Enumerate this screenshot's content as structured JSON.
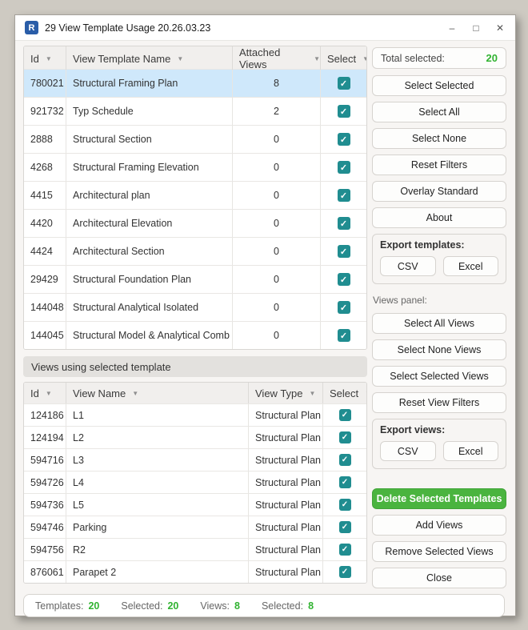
{
  "window": {
    "title": "29 View Template Usage 20.26.03.23",
    "icon_letter": "R",
    "controls": {
      "minimize": "–",
      "maximize": "□",
      "close": "✕"
    }
  },
  "colors": {
    "logo_blue": "#2a5da8",
    "accent_green": "#31b331",
    "checkbox_teal": "#208d90",
    "selected_row_blue": "#cfe8fb",
    "delete_button_green": "#4ab43f"
  },
  "icons": {
    "filter_arrow": "▼",
    "checkmark": "✓"
  },
  "templates_table": {
    "columns": [
      "Id",
      "View Template Name",
      "Attached Views",
      "Select"
    ],
    "rows": [
      {
        "id": "780021",
        "name": "Structural Framing Plan",
        "attached": "8",
        "checked": true,
        "selected": true
      },
      {
        "id": "921732",
        "name": "Typ Schedule",
        "attached": "2",
        "checked": true,
        "selected": false
      },
      {
        "id": "2888",
        "name": "Structural Section",
        "attached": "0",
        "checked": true,
        "selected": false
      },
      {
        "id": "4268",
        "name": "Structural Framing Elevation",
        "attached": "0",
        "checked": true,
        "selected": false
      },
      {
        "id": "4415",
        "name": "Architectural plan",
        "attached": "0",
        "checked": true,
        "selected": false
      },
      {
        "id": "4420",
        "name": "Architectural Elevation",
        "attached": "0",
        "checked": true,
        "selected": false
      },
      {
        "id": "4424",
        "name": "Architectural Section",
        "attached": "0",
        "checked": true,
        "selected": false
      },
      {
        "id": "29429",
        "name": "Structural Foundation Plan",
        "attached": "0",
        "checked": true,
        "selected": false
      },
      {
        "id": "144048",
        "name": "Structural Analytical Isolated",
        "attached": "0",
        "checked": true,
        "selected": false
      },
      {
        "id": "144045",
        "name": "Structural Model & Analytical Comb",
        "attached": "0",
        "checked": true,
        "selected": false
      }
    ]
  },
  "views_section_label": "Views using selected template",
  "views_table": {
    "columns": [
      "Id",
      "View Name",
      "View Type",
      "Select"
    ],
    "rows": [
      {
        "id": "124186",
        "name": "L1",
        "type": "Structural Plan",
        "checked": true
      },
      {
        "id": "124194",
        "name": "L2",
        "type": "Structural Plan",
        "checked": true
      },
      {
        "id": "594716",
        "name": "L3",
        "type": "Structural Plan",
        "checked": true
      },
      {
        "id": "594726",
        "name": "L4",
        "type": "Structural Plan",
        "checked": true
      },
      {
        "id": "594736",
        "name": "L5",
        "type": "Structural Plan",
        "checked": true
      },
      {
        "id": "594746",
        "name": "Parking",
        "type": "Structural Plan",
        "checked": true
      },
      {
        "id": "594756",
        "name": "R2",
        "type": "Structural Plan",
        "checked": true
      },
      {
        "id": "876061",
        "name": "Parapet 2",
        "type": "Structural Plan",
        "checked": true
      }
    ]
  },
  "panel": {
    "total_selected_label": "Total selected:",
    "total_selected_value": "20",
    "buttons_top": [
      "Select Selected",
      "Select All",
      "Select None",
      "Reset Filters",
      "Overlay Standard",
      "About"
    ],
    "export_templates": {
      "label": "Export templates:",
      "csv": "CSV",
      "excel": "Excel"
    },
    "views_panel_label": "Views panel:",
    "buttons_views": [
      "Select All Views",
      "Select None Views",
      "Select Selected Views",
      "Reset View Filters"
    ],
    "export_views": {
      "label": "Export views:",
      "csv": "CSV",
      "excel": "Excel"
    },
    "delete_button": "Delete Selected Templates",
    "buttons_bottom": [
      "Add Views",
      "Remove Selected Views",
      "Close"
    ]
  },
  "status_bar": [
    {
      "label": "Templates:",
      "value": "20"
    },
    {
      "label": "Selected:",
      "value": "20"
    },
    {
      "label": "Views:",
      "value": "8"
    },
    {
      "label": "Selected:",
      "value": "8"
    }
  ]
}
